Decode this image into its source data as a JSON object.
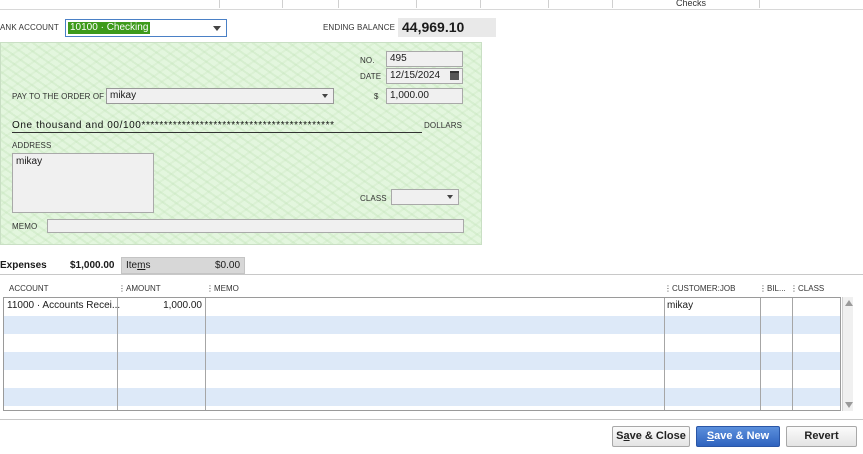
{
  "toolbar": {
    "checks_label": "Checks"
  },
  "bank": {
    "label": "ANK ACCOUNT",
    "account": "10100 · Checking",
    "ending_balance_label": "ENDING BALANCE",
    "ending_balance": "44,969.10"
  },
  "check": {
    "no_label": "NO.",
    "no": "495",
    "date_label": "DATE",
    "date": "12/15/2024",
    "pay_to_label": "PAY TO THE ORDER OF",
    "payee": "mikay",
    "dollar_sign": "$",
    "amount": "1,000.00",
    "amount_words": "One thousand  and 00/100*******************************************",
    "dollars_label": "DOLLARS",
    "address_label": "ADDRESS",
    "address": "mikay",
    "class_label": "CLASS",
    "memo_label": "MEMO",
    "memo": ""
  },
  "tabs": {
    "expenses_label": "Expenses",
    "expenses_amount": "$1,000.00",
    "items_label_pre": "Ite",
    "items_label_u": "m",
    "items_label_post": "s",
    "items_amount": "$0.00"
  },
  "grid": {
    "headers": [
      "ACCOUNT",
      "AMOUNT",
      "MEMO",
      "CUSTOMER:JOB",
      "BIL...",
      "CLASS"
    ],
    "rows": [
      {
        "account": "11000 · Accounts Recei...",
        "amount": "1,000.00",
        "memo": "",
        "customer": "mikay"
      }
    ]
  },
  "buttons": {
    "save_close_pre": "S",
    "save_close_u": "a",
    "save_close_post": "ve & Close",
    "save_new_u": "S",
    "save_new_post": "ave & New",
    "revert": "Revert"
  }
}
